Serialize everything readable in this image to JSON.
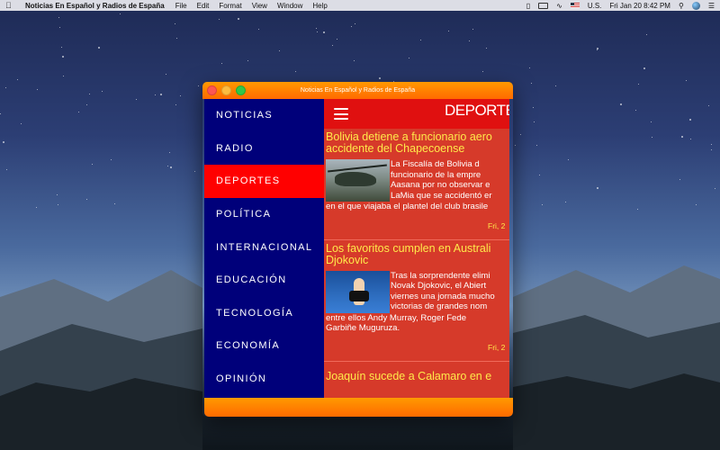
{
  "menubar": {
    "app_name": "Noticias En Español y Radios de España",
    "menus": [
      "File",
      "Edit",
      "Format",
      "View",
      "Window",
      "Help"
    ],
    "input_source": "U.S.",
    "clock": "Fri Jan 20  8:42 PM"
  },
  "window": {
    "title": "Noticias En Español y Radios de España"
  },
  "sidebar": {
    "items": [
      {
        "label": "NOTICIAS"
      },
      {
        "label": "RADIO"
      },
      {
        "label": "DEPORTES",
        "active": true
      },
      {
        "label": "POLÍTICA"
      },
      {
        "label": "INTERNACIONAL"
      },
      {
        "label": "EDUCACIÓN"
      },
      {
        "label": "TECNOLOGÍA"
      },
      {
        "label": "ECONOMÍA"
      },
      {
        "label": "OPINIÓN"
      }
    ]
  },
  "content": {
    "section_title": "DEPORTES",
    "articles": [
      {
        "headline_lines": [
          "Bolivia detiene a funcionario aero",
          "accidente del Chapecoense"
        ],
        "image_icon": "helicopter-crash-photo",
        "snippet_lines": [
          "La Fiscalía de Bolivia d",
          "funcionario de la empre",
          "Aasana por no observar e",
          "LaMia que se accidentó er"
        ],
        "after_lines": [
          "en el que viajaba el plantel del club brasile"
        ],
        "date": "Fri, 2"
      },
      {
        "headline_lines": [
          "Los favoritos cumplen en Australi",
          "Djokovic"
        ],
        "image_icon": "tennis-player-photo",
        "snippet_lines": [
          "Tras la sorprendente elimi",
          "Novak Djokovic, el Abiert",
          "viernes una jornada mucho",
          "victorias de grandes nom"
        ],
        "after_lines": [
          "entre ellos Andy Murray, Roger Fede",
          "Garbiñe Muguruza."
        ],
        "date": "Fri, 2"
      },
      {
        "headline_lines": [
          "Joaquín sucede a Calamaro en e"
        ],
        "image_icon": "",
        "snippet_lines": [],
        "after_lines": [],
        "date": ""
      }
    ]
  },
  "colors": {
    "titlebar": "#ff7a00",
    "sidebar_bg": "#00007a",
    "active_item": "#ff0000",
    "content_bg": "#d63a2a",
    "headline": "#ffe94a"
  }
}
